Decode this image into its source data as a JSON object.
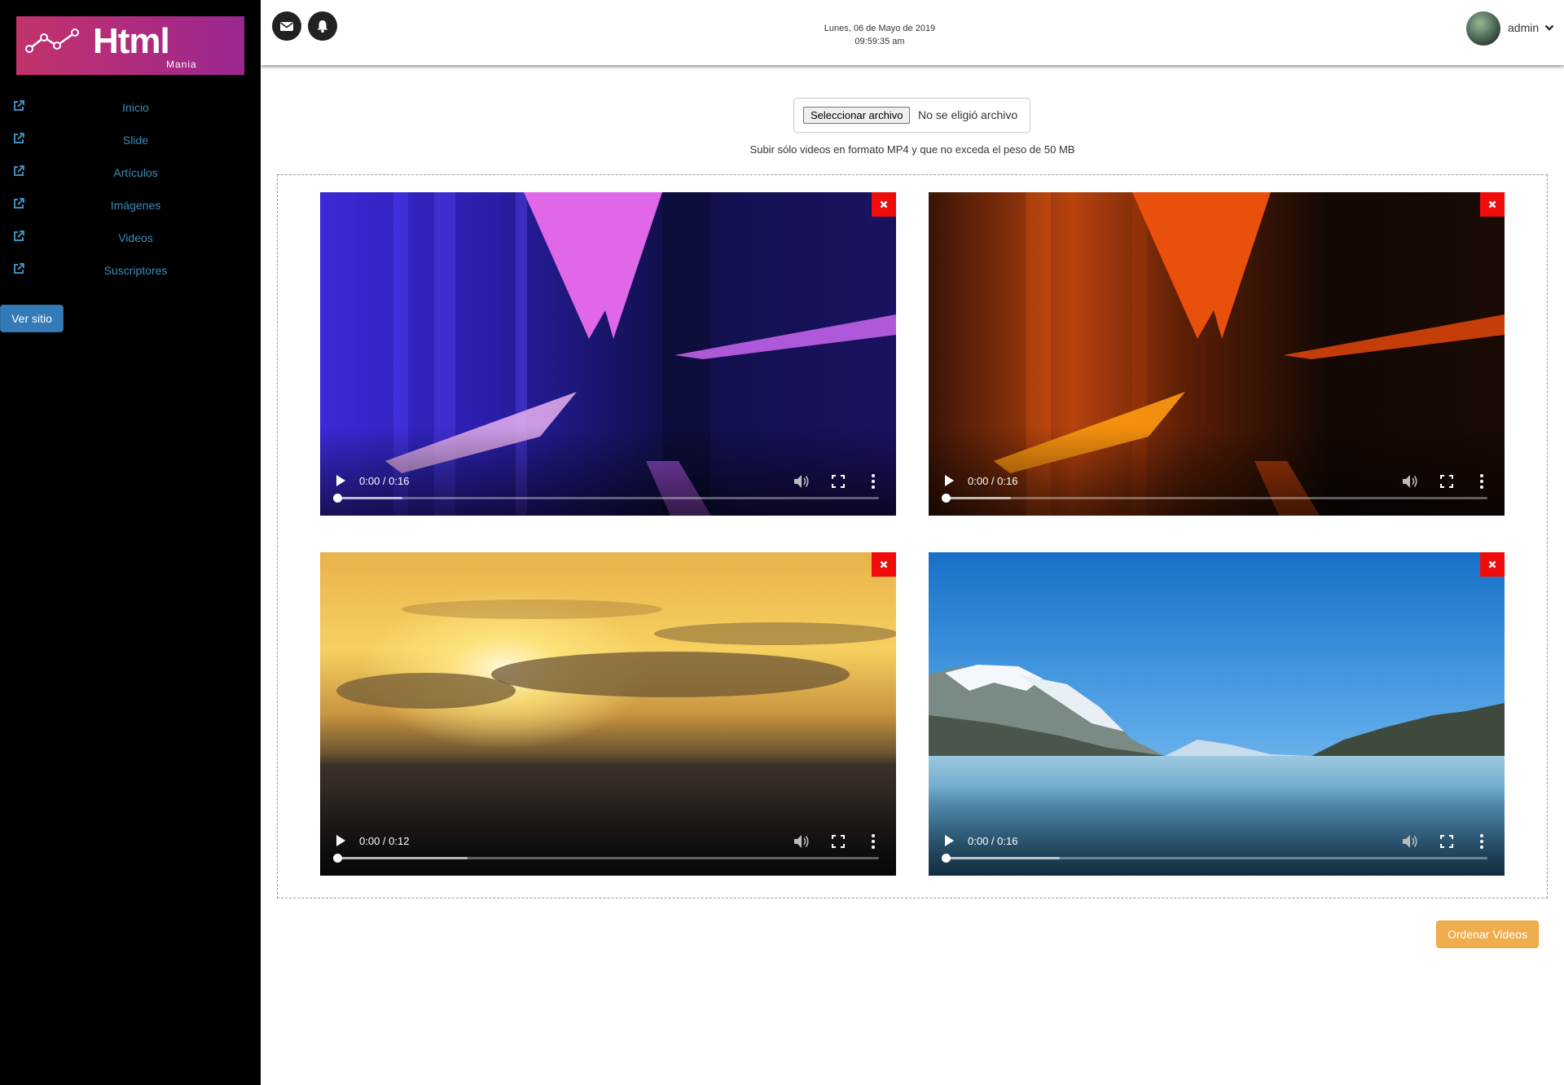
{
  "logo": {
    "title": "Html",
    "subtitle": "Mania"
  },
  "sidebar": {
    "items": [
      {
        "label": "Inicio",
        "icon": "external-link-icon"
      },
      {
        "label": "Slide",
        "icon": "external-link-icon"
      },
      {
        "label": "Artículos",
        "icon": "external-link-icon"
      },
      {
        "label": "Imágenes",
        "icon": "external-link-icon"
      },
      {
        "label": "Videos",
        "icon": "external-link-icon"
      },
      {
        "label": "Suscriptores",
        "icon": "external-link-icon"
      }
    ],
    "view_site": "Ver sitio"
  },
  "header": {
    "date": "Lunes, 06 de Mayo de 2019",
    "time": "09:59:35 am",
    "user": "admin",
    "icons": [
      "envelope-icon",
      "bell-icon",
      "chevron-down-icon"
    ]
  },
  "upload": {
    "button_label": "Seleccionar archivo",
    "status": "No se eligió archivo",
    "hint": "Subir sólo videos en formato MP4 y que no exceda el peso de 50 MB"
  },
  "videos": [
    {
      "time": "0:00 / 0:16",
      "buffered": 0.12,
      "scene": "purple-lights"
    },
    {
      "time": "0:00 / 0:16",
      "buffered": 0.12,
      "scene": "orange-lights"
    },
    {
      "time": "0:00 / 0:12",
      "buffered": 0.24,
      "scene": "sunset"
    },
    {
      "time": "0:00 / 0:16",
      "buffered": 0.21,
      "scene": "mountain-lake"
    }
  ],
  "actions": {
    "order_label": "Ordenar Videos"
  },
  "colors": {
    "sidebar_bg": "#000000",
    "link": "#3c8dbc",
    "primary": "#337ab7",
    "warning": "#f0ad4e",
    "danger": "#f10c0c"
  }
}
